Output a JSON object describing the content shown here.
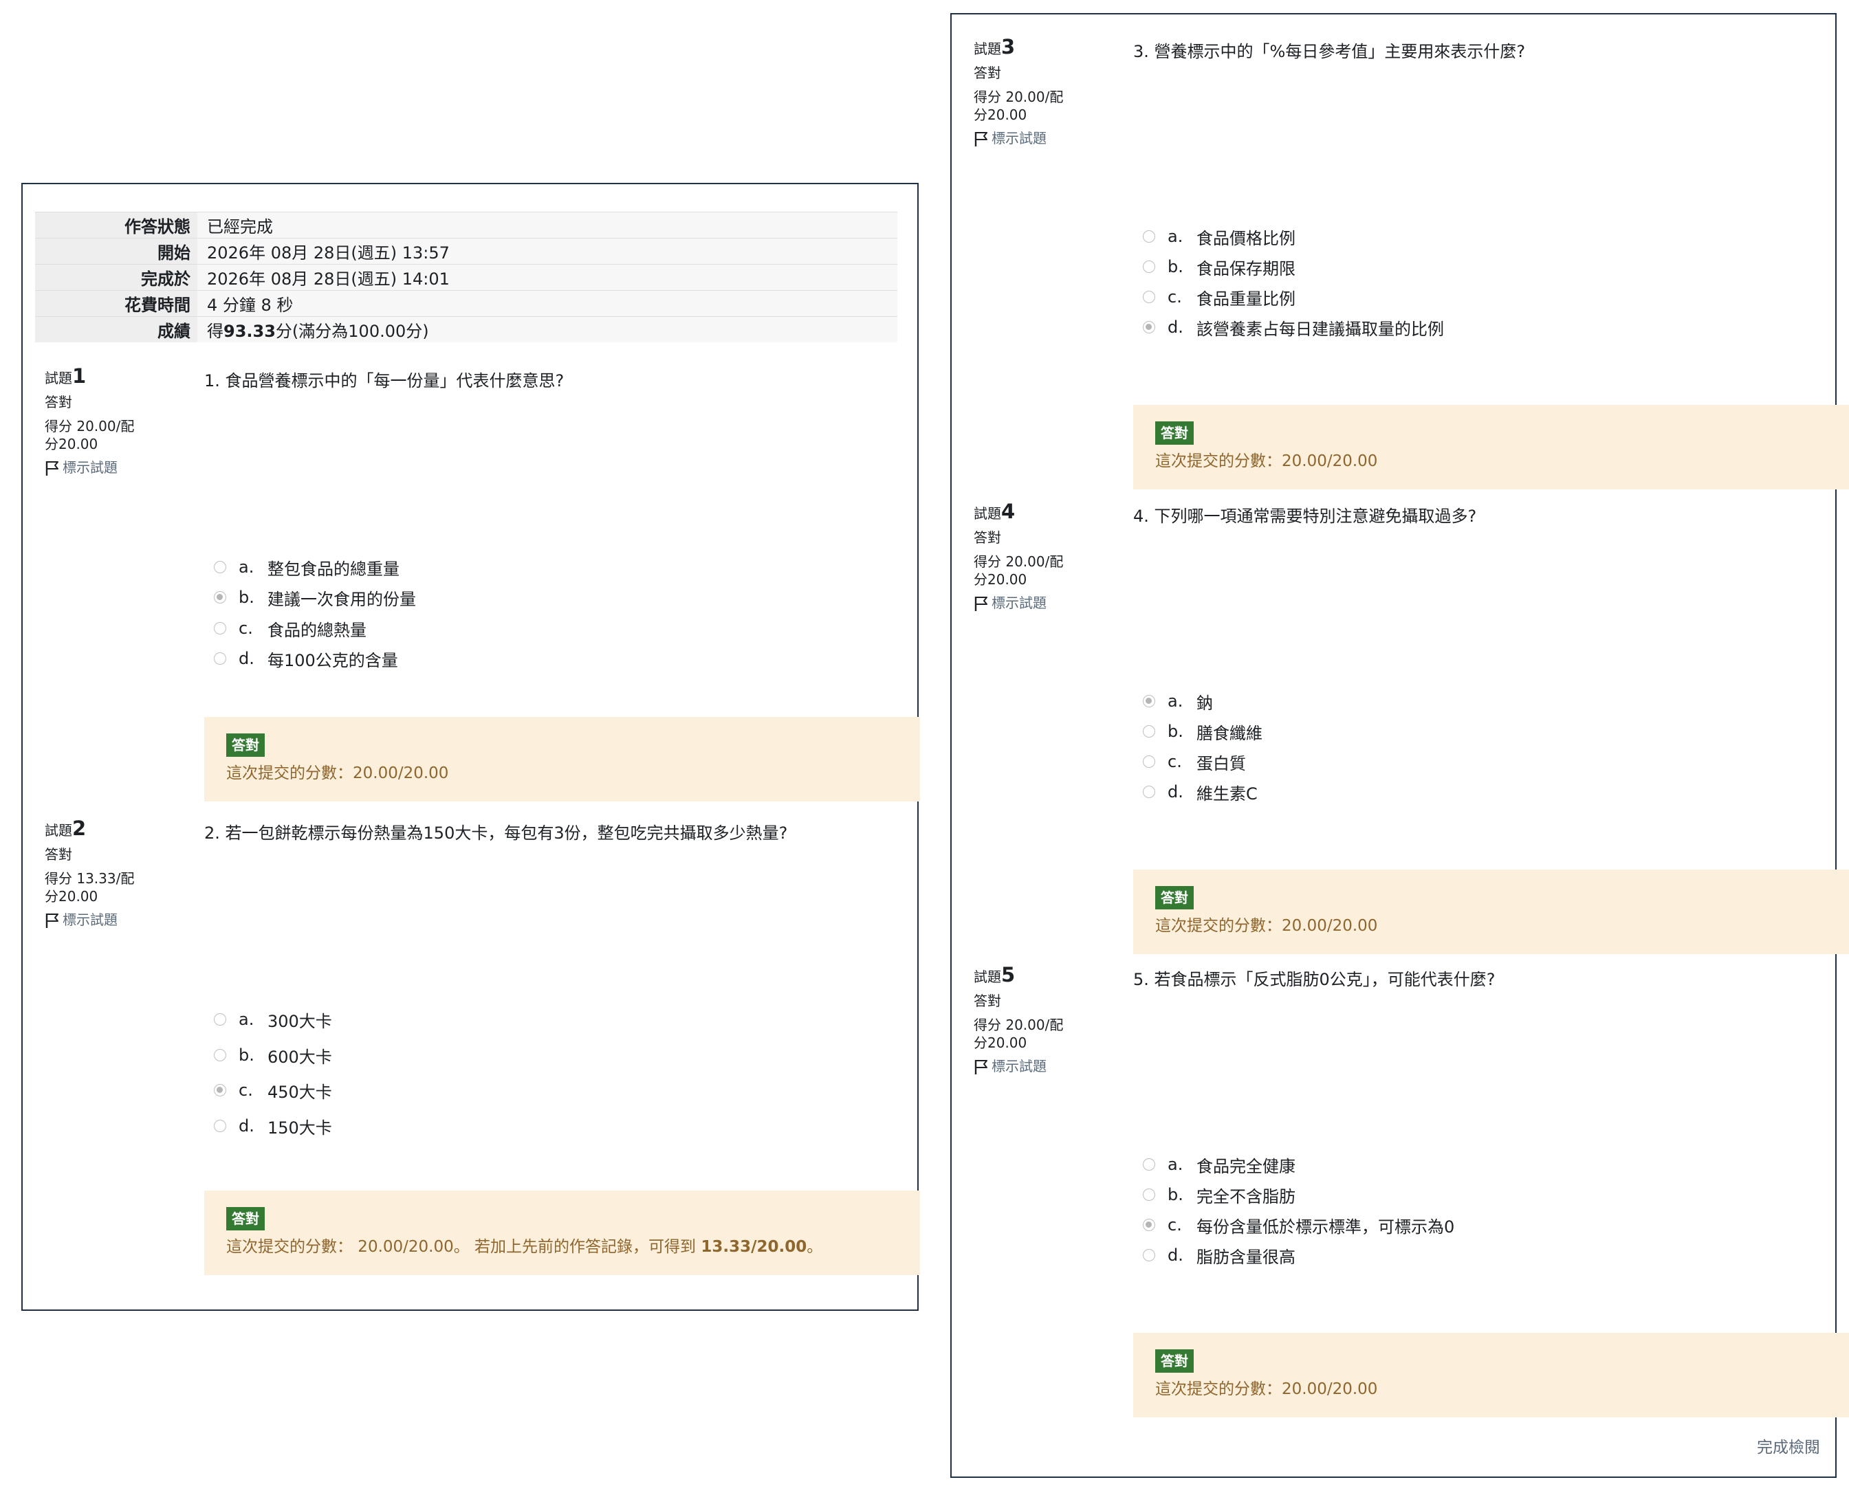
{
  "summary": {
    "state_label": "作答狀態",
    "state_value": "已經完成",
    "start_label": "開始",
    "start_value": "2026年 08月 28日(週五) 13:57",
    "done_label": "完成於",
    "done_value": "2026年 08月 28日(週五) 14:01",
    "time_label": "花費時間",
    "time_value": "4 分鐘 8 秒",
    "grade_label": "成績",
    "grade_prefix": "得",
    "grade_value": "93.33",
    "grade_suffix": "分(滿分為100.00分)"
  },
  "questions": [
    {
      "prefix": "試題",
      "number": "1",
      "state": "答對",
      "grade_line1": "得分 20.00/配",
      "grade_line2": "分20.00",
      "flag_label": "標示試題",
      "text": "1. 食品營養標示中的「每一份量」代表什麼意思?",
      "answers": [
        {
          "letter": "a.",
          "text": "整包食品的總重量",
          "checked": false
        },
        {
          "letter": "b.",
          "text": "建議一次食用的份量",
          "checked": true
        },
        {
          "letter": "c.",
          "text": "食品的總熱量",
          "checked": false
        },
        {
          "letter": "d.",
          "text": "每100公克的含量",
          "checked": false
        }
      ],
      "badge": "答對",
      "feedback": "這次提交的分數：20.00/20.00",
      "feedback_extra": "",
      "feedback_bold": "",
      "feedback_end": ""
    },
    {
      "prefix": "試題",
      "number": "2",
      "state": "答對",
      "grade_line1": "得分 13.33/配",
      "grade_line2": "分20.00",
      "flag_label": "標示試題",
      "text": "2. 若一包餅乾標示每份熱量為150大卡，每包有3份，整包吃完共攝取多少熱量?",
      "answers": [
        {
          "letter": "a.",
          "text": "300大卡",
          "checked": false
        },
        {
          "letter": "b.",
          "text": "600大卡",
          "checked": false
        },
        {
          "letter": "c.",
          "text": "450大卡",
          "checked": true
        },
        {
          "letter": "d.",
          "text": "150大卡",
          "checked": false
        }
      ],
      "badge": "答對",
      "feedback": "這次提交的分數： 20.00/20.00。",
      "feedback_extra": " 若加上先前的作答記錄，可得到 ",
      "feedback_bold": "13.33/20.00",
      "feedback_end": "。"
    },
    {
      "prefix": "試題",
      "number": "3",
      "state": "答對",
      "grade_line1": "得分 20.00/配",
      "grade_line2": "分20.00",
      "flag_label": "標示試題",
      "text": "3. 營養標示中的「%每日參考值」主要用來表示什麼?",
      "answers": [
        {
          "letter": "a.",
          "text": "食品價格比例",
          "checked": false
        },
        {
          "letter": "b.",
          "text": "食品保存期限",
          "checked": false
        },
        {
          "letter": "c.",
          "text": "食品重量比例",
          "checked": false
        },
        {
          "letter": "d.",
          "text": "該營養素占每日建議攝取量的比例",
          "checked": true
        }
      ],
      "badge": "答對",
      "feedback": "這次提交的分數：20.00/20.00",
      "feedback_extra": "",
      "feedback_bold": "",
      "feedback_end": ""
    },
    {
      "prefix": "試題",
      "number": "4",
      "state": "答對",
      "grade_line1": "得分 20.00/配",
      "grade_line2": "分20.00",
      "flag_label": "標示試題",
      "text": "4. 下列哪一項通常需要特別注意避免攝取過多?",
      "answers": [
        {
          "letter": "a.",
          "text": "鈉",
          "checked": true
        },
        {
          "letter": "b.",
          "text": "膳食纖維",
          "checked": false
        },
        {
          "letter": "c.",
          "text": "蛋白質",
          "checked": false
        },
        {
          "letter": "d.",
          "text": "維生素C",
          "checked": false
        }
      ],
      "badge": "答對",
      "feedback": "這次提交的分數：20.00/20.00",
      "feedback_extra": "",
      "feedback_bold": "",
      "feedback_end": ""
    },
    {
      "prefix": "試題",
      "number": "5",
      "state": "答對",
      "grade_line1": "得分 20.00/配",
      "grade_line2": "分20.00",
      "flag_label": "標示試題",
      "text": "5. 若食品標示「反式脂肪0公克」，可能代表什麼?",
      "answers": [
        {
          "letter": "a.",
          "text": "食品完全健康",
          "checked": false
        },
        {
          "letter": "b.",
          "text": "完全不含脂肪",
          "checked": false
        },
        {
          "letter": "c.",
          "text": "每份含量低於標示標準，可標示為0",
          "checked": true
        },
        {
          "letter": "d.",
          "text": "脂肪含量很高",
          "checked": false
        }
      ],
      "badge": "答對",
      "feedback": "這次提交的分數：20.00/20.00",
      "feedback_extra": "",
      "feedback_bold": "",
      "feedback_end": ""
    }
  ],
  "finish_review": "完成檢閱"
}
